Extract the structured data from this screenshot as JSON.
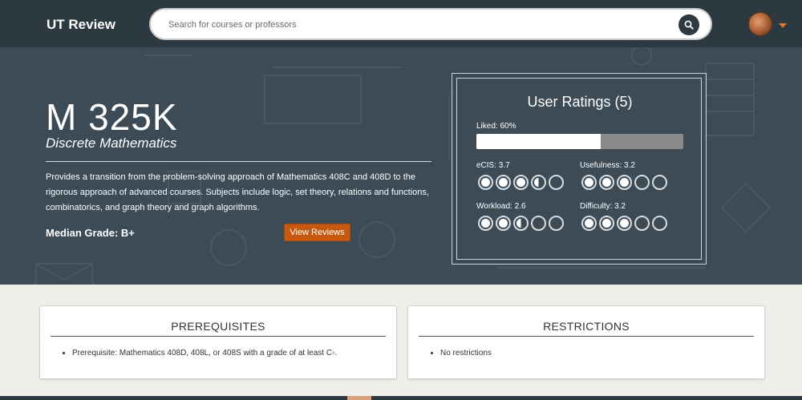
{
  "app": {
    "brand": "UT Review"
  },
  "search": {
    "placeholder": "Search for courses or professors",
    "value": ""
  },
  "course": {
    "code": "M 325K",
    "name": "Discrete Mathematics",
    "description": "Provides a transition from the problem-solving approach of Mathematics 408C and 408D to the rigorous approach of advanced courses. Subjects include logic, set theory, relations and functions, combinatorics, and graph theory and graph algorithms.",
    "median_grade": "Median Grade: B+",
    "view_reviews_label": "View Reviews"
  },
  "ratings": {
    "title": "User Ratings (5)",
    "liked_label": "Liked: 60%",
    "liked_percent": 60,
    "metrics": [
      {
        "label": "eCIS: 3.7",
        "value": 3.7
      },
      {
        "label": "Usefulness: 3.2",
        "value": 3.2
      },
      {
        "label": "Workload: 2.6",
        "value": 2.6
      },
      {
        "label": "Difficulty: 3.2",
        "value": 3.2
      }
    ],
    "max_score": 5
  },
  "prerequisites": {
    "title": "PREREQUISITES",
    "items": [
      "Prerequisite: Mathematics 408D, 408L, or 408S with a grade of at least C-."
    ]
  },
  "restrictions": {
    "title": "RESTRICTIONS",
    "items": [
      "No restrictions"
    ]
  },
  "icons": {
    "search": "search-icon",
    "avatar": "user-avatar",
    "dropdown": "caret-down-icon"
  },
  "colors": {
    "nav": "#2d3940",
    "hero": "#3c4b56",
    "accent": "#c6580f",
    "background": "#efeee9"
  }
}
